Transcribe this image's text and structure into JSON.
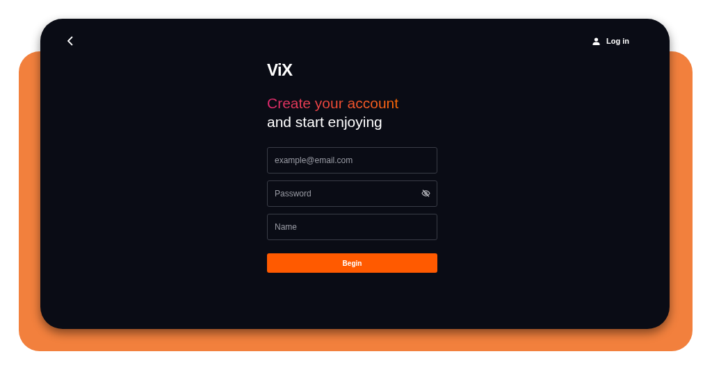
{
  "header": {
    "login_link": "Log in"
  },
  "logo": "ViX",
  "heading": {
    "line_1": "Create your account",
    "line_2": "and start enjoying"
  },
  "fields": [
    {
      "kind": "email",
      "placeholder": "example@email.com"
    },
    {
      "kind": "password",
      "placeholder": "Password"
    },
    {
      "kind": "text",
      "placeholder": "Name"
    }
  ],
  "submit_button": "Begin"
}
